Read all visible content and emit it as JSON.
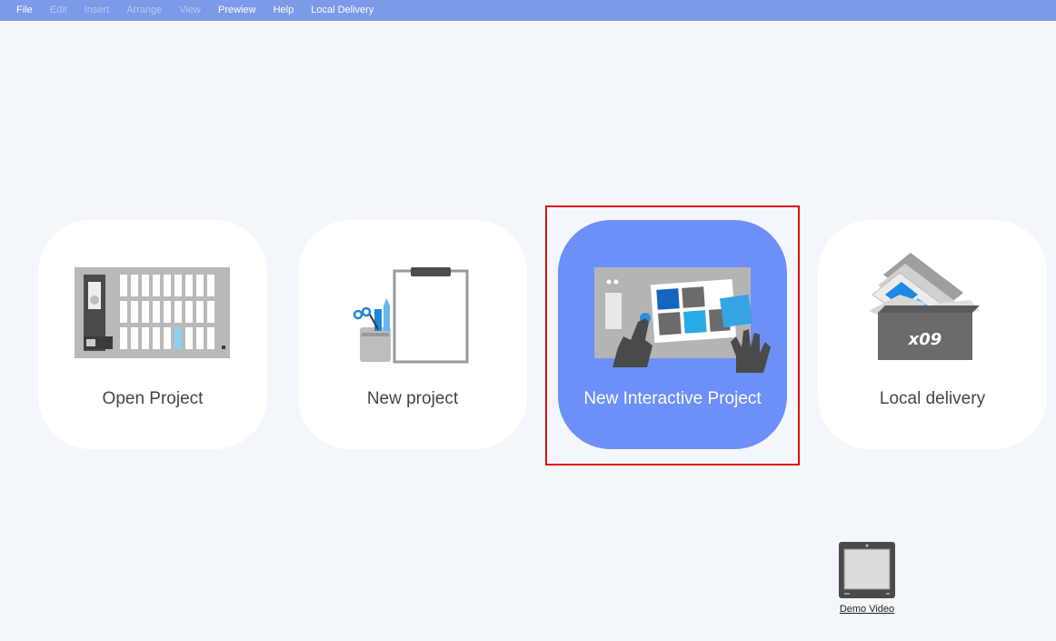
{
  "menu": {
    "file": "File",
    "edit": "Edit",
    "insert": "Insert",
    "arrange": "Arrange",
    "view": "View",
    "preview": "Prewiew",
    "help": "Help",
    "local_delivery": "Local Delivery"
  },
  "cards": {
    "open_project": "Open Project",
    "new_project": "New project",
    "new_interactive_project": "New Interactive Project",
    "local_delivery": "Local delivery"
  },
  "box_text": "x09",
  "demo_video": "Demo Video",
  "colors": {
    "menubar": "#7b9ae8",
    "active_card": "#6c8ff8",
    "highlight": "#e01010",
    "background": "#f3f7fc"
  }
}
